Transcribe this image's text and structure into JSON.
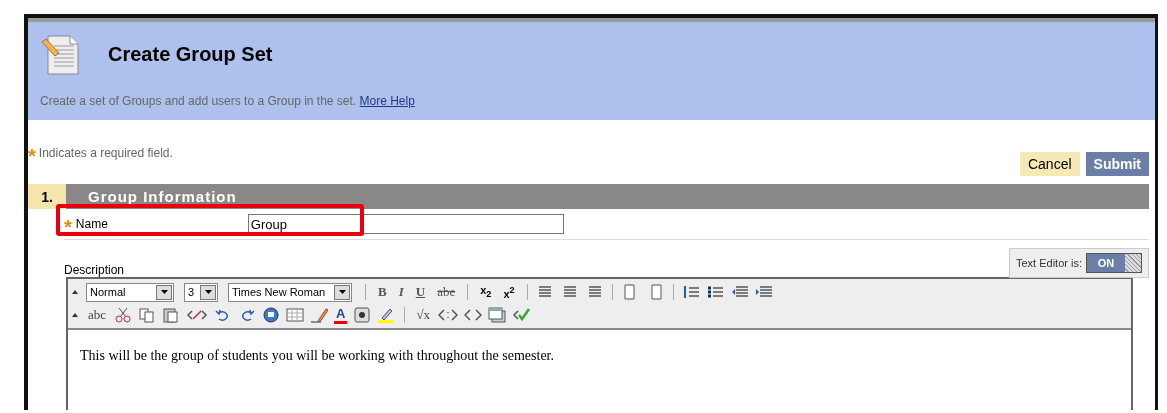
{
  "header": {
    "title": "Create Group Set",
    "description": "Create a set of Groups and add users to a Group in the set.",
    "help_link": "More Help"
  },
  "required_note": "Indicates a required field.",
  "required_mark": "*",
  "buttons": [
    {
      "label": "Cancel",
      "kind": "secondary"
    },
    {
      "label": "Submit",
      "kind": "primary"
    }
  ],
  "section": {
    "number": "1.",
    "title": "Group Information"
  },
  "name_field": {
    "label": "Name",
    "value": "Group",
    "required": true,
    "highlighted": true
  },
  "description": {
    "label": "Description",
    "editor_toggle_label": "Text Editor is:",
    "editor_toggle": "ON",
    "editor_on": true
  },
  "toolbar": {
    "dropdowns": [
      {
        "value": "Normal"
      },
      {
        "value": "3"
      },
      {
        "value": "Times New Roman"
      }
    ],
    "format_buttons": [
      {
        "label": "B",
        "kind": "bold"
      },
      {
        "label": "I",
        "kind": "italic"
      },
      {
        "label": "U",
        "kind": "underline"
      },
      {
        "label": "abe",
        "kind": "strike"
      }
    ],
    "script_buttons": [
      "x$_{2}$",
      "x$^{2}$"
    ],
    "spell_label": "abc",
    "font_color_label": "A",
    "math_label": "√x"
  },
  "editor_text": "This will be the group of students you will be working with throughout the semester."
}
